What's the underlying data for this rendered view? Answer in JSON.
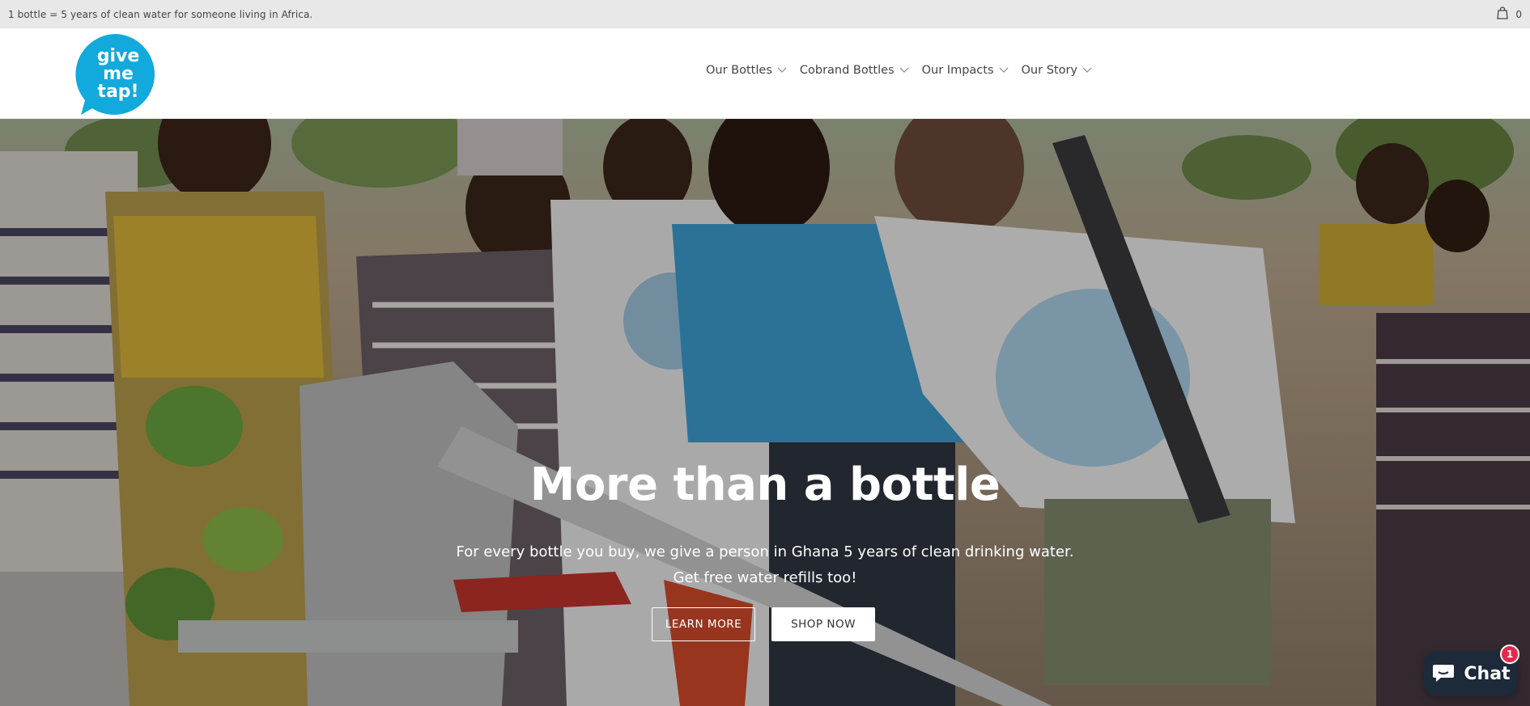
{
  "announcement": {
    "text": "1 bottle = 5 years of clean water for someone living in Africa.",
    "cart_count": "0"
  },
  "header": {
    "logo_text": [
      "give",
      "me",
      "tap!"
    ],
    "brand_color": "#12a9dd",
    "nav": [
      {
        "label": "Our Bottles",
        "icon": "chevron-down-icon"
      },
      {
        "label": "Cobrand Bottles",
        "icon": "chevron-down-icon"
      },
      {
        "label": "Our Impacts",
        "icon": "chevron-down-icon"
      },
      {
        "label": "Our Story",
        "icon": "chevron-down-icon"
      }
    ]
  },
  "hero": {
    "title": "More than a bottle",
    "subtitle_line1": "For every bottle you buy, we give a person in Ghana 5 years of clean drinking water.",
    "subtitle_line2": "Get free water refills too!",
    "learn_more_label": "LEARN MORE",
    "shop_now_label": "SHOP NOW"
  },
  "chat": {
    "label": "Chat",
    "badge": "1",
    "color": "#1c2a3a",
    "badge_color": "#e5294b"
  }
}
